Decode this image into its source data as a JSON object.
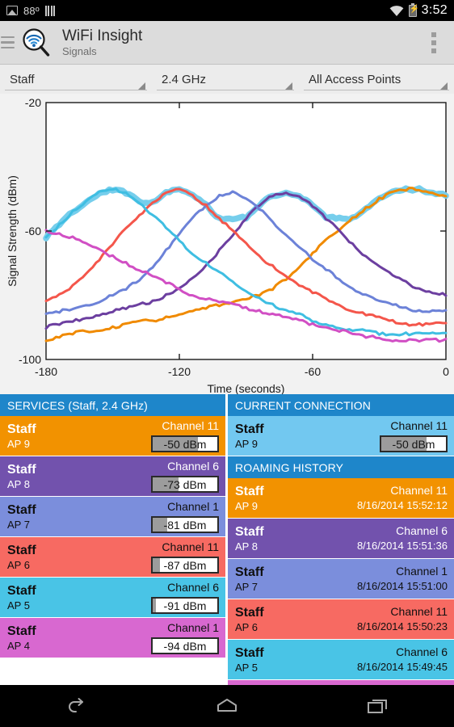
{
  "statusbar": {
    "photo_icon": "photo-icon",
    "temperature": "88º",
    "bars_icon": "signal-bars-icon",
    "wifi_icon": "wifi-icon",
    "battery_icon": "battery-charging-icon",
    "time": "3:52"
  },
  "actionbar": {
    "menu_icon": "hamburger-menu-icon",
    "logo_icon": "wifi-magnifier-logo-icon",
    "title": "WiFi Insight",
    "subtitle": "Signals",
    "overflow_icon": "overflow-menu-icon"
  },
  "filters": [
    {
      "label": "Staff"
    },
    {
      "label": "2.4 GHz"
    },
    {
      "label": "All Access Points"
    }
  ],
  "chart_data": {
    "type": "line",
    "title": "",
    "xlabel": "Time (seconds)",
    "ylabel": "Signal Strength (dBm)",
    "xlim": [
      -180,
      0
    ],
    "ylim": [
      -100,
      -20
    ],
    "xticks": [
      -180,
      -120,
      -60,
      0
    ],
    "xticklabels": [
      "-180",
      "-120",
      "-60",
      "0"
    ],
    "yticks": [
      -100,
      -60,
      -20
    ],
    "yticklabels": [
      "-100",
      "-60",
      "-20"
    ],
    "grid": false,
    "legend": "none",
    "x": [
      -180,
      -174,
      -168,
      -162,
      -156,
      -150,
      -144,
      -138,
      -132,
      -126,
      -120,
      -114,
      -108,
      -102,
      -96,
      -90,
      -84,
      -78,
      -72,
      -66,
      -60,
      -54,
      -48,
      -42,
      -36,
      -30,
      -24,
      -18,
      -12,
      -6,
      0
    ],
    "series": [
      {
        "name": "AP 9",
        "color": "#F08A00",
        "values": [
          -94,
          -93,
          -92,
          -91,
          -91,
          -90,
          -89,
          -88,
          -88,
          -87,
          -86,
          -85,
          -84,
          -83,
          -82,
          -81,
          -80,
          -78,
          -75,
          -71,
          -67,
          -63,
          -60,
          -56,
          -53,
          -50,
          -48,
          -47,
          -47,
          -48,
          -49
        ]
      },
      {
        "name": "AP 8",
        "color": "#6C3FA0",
        "values": [
          -90,
          -89,
          -88,
          -87,
          -86,
          -85,
          -84,
          -83,
          -82,
          -80,
          -78,
          -75,
          -71,
          -66,
          -61,
          -56,
          -52,
          -49,
          -48,
          -49,
          -52,
          -56,
          -60,
          -64,
          -68,
          -71,
          -74,
          -76,
          -78,
          -79,
          -80
        ]
      },
      {
        "name": "AP 7",
        "color": "#6C82D8",
        "values": [
          -86,
          -85,
          -84,
          -83,
          -82,
          -80,
          -78,
          -75,
          -71,
          -66,
          -61,
          -56,
          -52,
          -49,
          -48,
          -50,
          -53,
          -57,
          -61,
          -65,
          -69,
          -72,
          -75,
          -78,
          -80,
          -82,
          -83,
          -84,
          -85,
          -85,
          -85
        ]
      },
      {
        "name": "AP 6",
        "color": "#F4564B",
        "values": [
          -82,
          -80,
          -77,
          -73,
          -69,
          -64,
          -59,
          -55,
          -51,
          -48,
          -47,
          -49,
          -52,
          -56,
          -60,
          -64,
          -68,
          -71,
          -74,
          -77,
          -79,
          -81,
          -83,
          -85,
          -86,
          -87,
          -88,
          -89,
          -89,
          -89,
          -89
        ]
      },
      {
        "name": "AP 5",
        "color": "#3FBEE2",
        "values": [
          -62,
          -58,
          -54,
          -51,
          -48,
          -47,
          -48,
          -51,
          -55,
          -59,
          -63,
          -67,
          -70,
          -73,
          -76,
          -79,
          -81,
          -83,
          -85,
          -86,
          -88,
          -89,
          -90,
          -91,
          -91,
          -92,
          -92,
          -92,
          -92,
          -92,
          -92
        ]
      },
      {
        "name": "AP 4",
        "color": "#D14FC4",
        "values": [
          -60,
          -61,
          -62,
          -64,
          -66,
          -68,
          -70,
          -72,
          -74,
          -76,
          -78,
          -80,
          -81,
          -82,
          -83,
          -84,
          -85,
          -86,
          -87,
          -88,
          -89,
          -90,
          -91,
          -92,
          -93,
          -93,
          -94,
          -94,
          -94,
          -94,
          -94
        ]
      }
    ],
    "connection_highlight": {
      "name": "Current connection",
      "color": "#76CEEC",
      "values": [
        -62,
        -58,
        -54,
        -51,
        -48,
        -47,
        -48,
        -51,
        -51,
        -48,
        -47,
        -49,
        -52,
        -56,
        -56,
        -56,
        -52,
        -49,
        -48,
        -49,
        -52,
        -56,
        -56,
        -56,
        -53,
        -50,
        -48,
        -47,
        -47,
        -48,
        -49
      ]
    }
  },
  "services_panel": {
    "header": "SERVICES (Staff, 2.4 GHz)",
    "rows": [
      {
        "ssid": "Staff",
        "ap": "AP 9",
        "channel": "Channel 11",
        "dbm": "-50 dBm",
        "fill_pct": 70,
        "bg": "#F29200",
        "text": "light"
      },
      {
        "ssid": "Staff",
        "ap": "AP 8",
        "channel": "Channel 6",
        "dbm": "-73 dBm",
        "fill_pct": 40,
        "bg": "#7252AD",
        "text": "light"
      },
      {
        "ssid": "Staff",
        "ap": "AP 7",
        "channel": "Channel 1",
        "dbm": "-81 dBm",
        "fill_pct": 23,
        "bg": "#7B8EDC",
        "text": "dark"
      },
      {
        "ssid": "Staff",
        "ap": "AP 6",
        "channel": "Channel 11",
        "dbm": "-87 dBm",
        "fill_pct": 11,
        "bg": "#F76A62",
        "text": "dark"
      },
      {
        "ssid": "Staff",
        "ap": "AP 5",
        "channel": "Channel 6",
        "dbm": "-91 dBm",
        "fill_pct": 5,
        "bg": "#49C4E6",
        "text": "dark"
      },
      {
        "ssid": "Staff",
        "ap": "AP 4",
        "channel": "Channel 1",
        "dbm": "-94 dBm",
        "fill_pct": 0,
        "bg": "#D868D0",
        "text": "dark"
      }
    ]
  },
  "current_connection_panel": {
    "header": "CURRENT CONNECTION",
    "row": {
      "ssid": "Staff",
      "ap": "AP 9",
      "channel": "Channel 11",
      "dbm": "-50 dBm",
      "fill_pct": 70,
      "bg": "#72C8F0",
      "text": "dark"
    }
  },
  "roaming_panel": {
    "header": "ROAMING HISTORY",
    "rows": [
      {
        "ssid": "Staff",
        "ap": "AP 9",
        "channel": "Channel 11",
        "timestamp": "8/16/2014 15:52:12",
        "bg": "#F29200",
        "text": "light"
      },
      {
        "ssid": "Staff",
        "ap": "AP 8",
        "channel": "Channel 6",
        "timestamp": "8/16/2014 15:51:36",
        "bg": "#7252AD",
        "text": "light"
      },
      {
        "ssid": "Staff",
        "ap": "AP 7",
        "channel": "Channel 1",
        "timestamp": "8/16/2014 15:51:00",
        "bg": "#7B8EDC",
        "text": "dark"
      },
      {
        "ssid": "Staff",
        "ap": "AP 6",
        "channel": "Channel 11",
        "timestamp": "8/16/2014 15:50:23",
        "bg": "#F76A62",
        "text": "dark"
      },
      {
        "ssid": "Staff",
        "ap": "AP 5",
        "channel": "Channel 6",
        "timestamp": "8/16/2014 15:49:45",
        "bg": "#49C4E6",
        "text": "dark"
      },
      {
        "ssid": "Staff",
        "ap": "",
        "channel": "",
        "timestamp": "",
        "bg": "#D868D0",
        "text": "dark"
      }
    ]
  },
  "navbar": {
    "back_icon": "back-icon",
    "home_icon": "home-icon",
    "recents_icon": "recent-apps-icon"
  }
}
